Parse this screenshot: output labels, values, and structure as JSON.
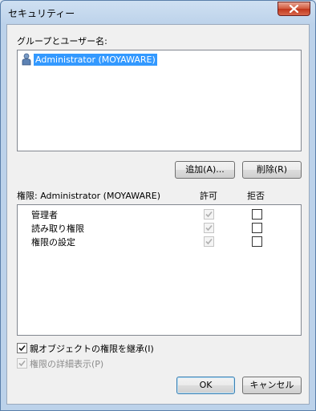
{
  "window": {
    "title": "セキュリティー"
  },
  "groups": {
    "label": "グループとユーザー名:",
    "items": [
      {
        "name": "Administrator (MOYAWARE)",
        "selected": true,
        "icon": "user-icon"
      }
    ]
  },
  "buttons": {
    "add": "追加(A)...",
    "remove": "削除(R)",
    "ok": "OK",
    "cancel": "キャンセル"
  },
  "permissions": {
    "label": "権限: Administrator (MOYAWARE)",
    "allow_header": "許可",
    "deny_header": "拒否",
    "rows": [
      {
        "name": "管理者",
        "allow": true,
        "allow_disabled": true,
        "deny": false
      },
      {
        "name": "読み取り権限",
        "allow": true,
        "allow_disabled": true,
        "deny": false
      },
      {
        "name": "権限の設定",
        "allow": true,
        "allow_disabled": true,
        "deny": false
      }
    ]
  },
  "options": {
    "inherit": {
      "label": "親オブジェクトの権限を継承(I)",
      "checked": true
    },
    "details": {
      "label": "権限の詳細表示(P)",
      "checked": true,
      "disabled": true
    }
  },
  "colors": {
    "selection": "#3399ff",
    "close_button": "#c0361b"
  }
}
